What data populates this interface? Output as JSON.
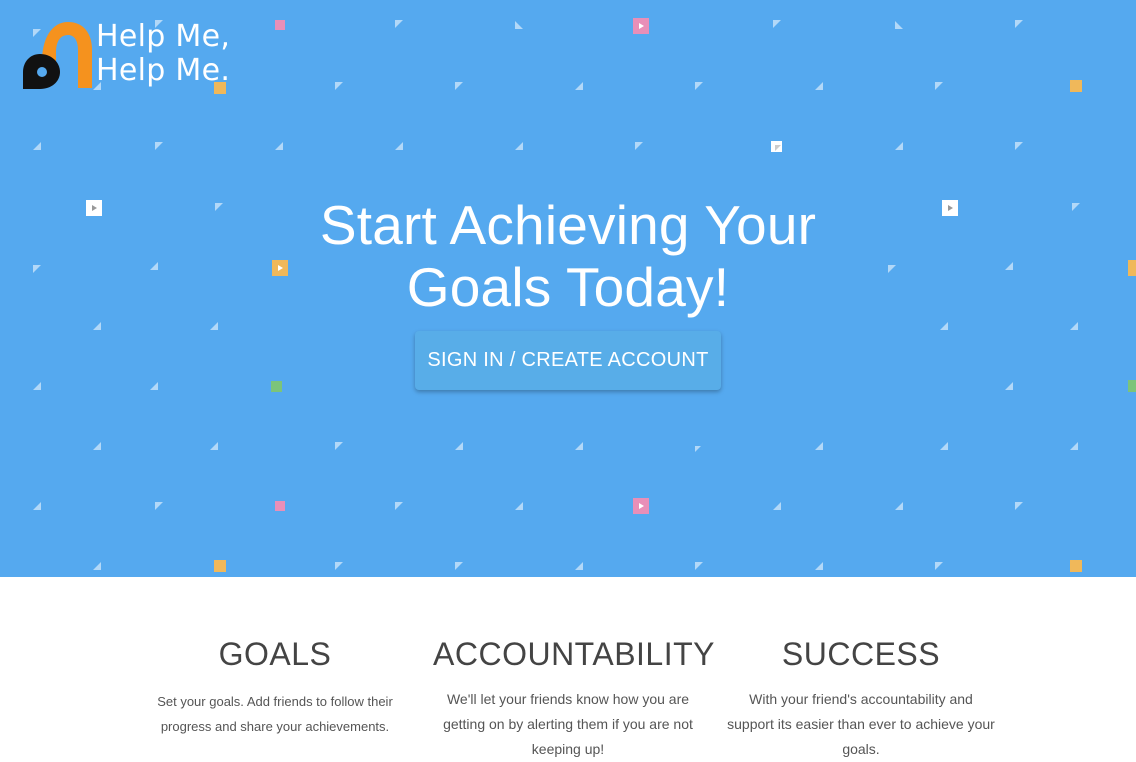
{
  "brand": {
    "line1": "Help Me,",
    "line2": "Help Me.",
    "logo_color": "#f5921e",
    "logo_dark": "#111111"
  },
  "hero": {
    "background": "#55a9ef",
    "headline_line1": "Start Achieving Your",
    "headline_line2": "Goals Today!",
    "cta_label": "SIGN IN / CREATE ACCOUNT"
  },
  "features": [
    {
      "title": "GOALS",
      "text": "Set your goals. Add friends to follow their progress and share your achievements."
    },
    {
      "title": "ACCOUNTABILITY",
      "text": "We'll let your friends know how you are getting on by alerting them if you are not keeping up!"
    },
    {
      "title": "SUCCESS",
      "text": "With your friend's accountability and support its easier than ever to achieve your goals."
    }
  ]
}
